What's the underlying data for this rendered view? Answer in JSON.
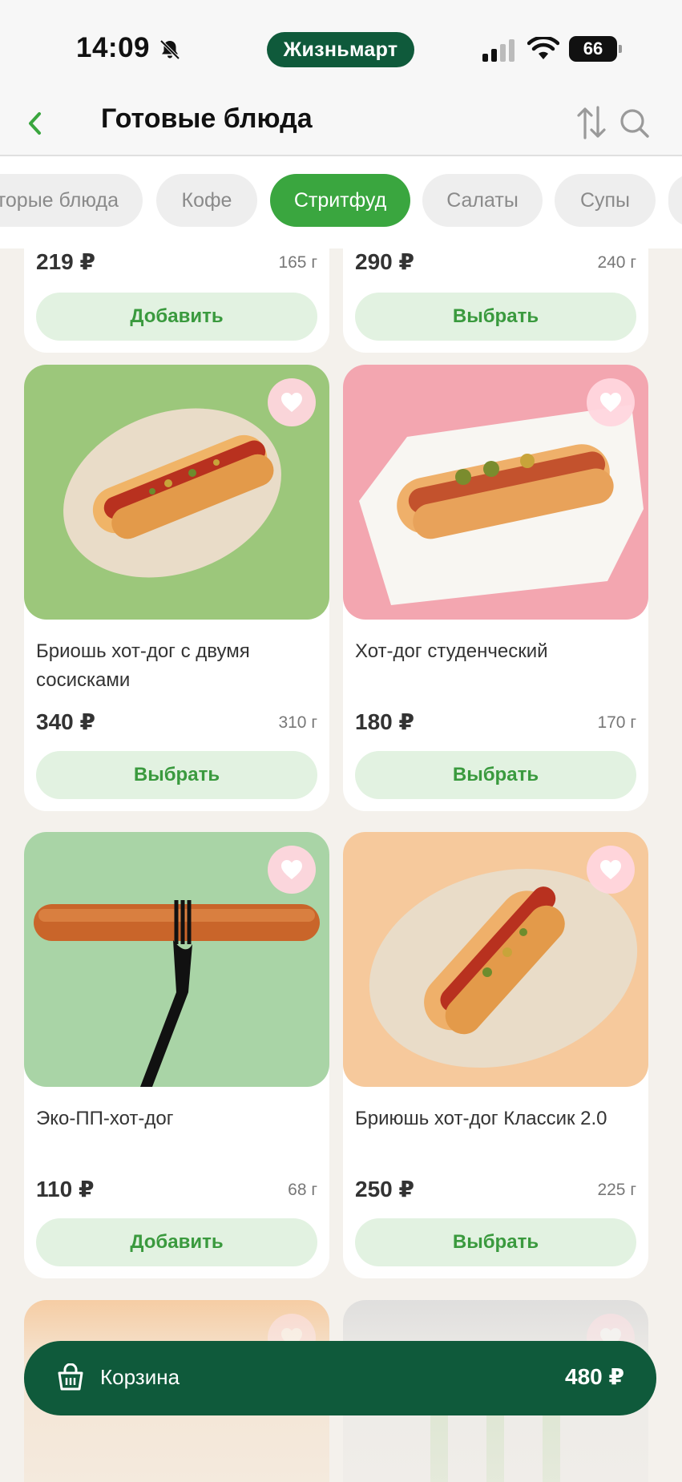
{
  "status_bar": {
    "time": "14:09",
    "brand": "Жизньмарт",
    "battery": "66"
  },
  "header": {
    "title": "Готовые блюда"
  },
  "tabs": [
    {
      "label": "Вторые блюда",
      "active": false
    },
    {
      "label": "Кофе",
      "active": false
    },
    {
      "label": "Стритфуд",
      "active": true
    },
    {
      "label": "Салаты",
      "active": false
    },
    {
      "label": "Супы",
      "active": false
    }
  ],
  "partial_row": [
    {
      "price": "219 ₽",
      "weight": "165 г",
      "button": "Добавить"
    },
    {
      "price": "290 ₽",
      "weight": "240 г",
      "button": "Выбрать"
    }
  ],
  "products": [
    {
      "name": "Бриошь хот-дог с двумя сосисками",
      "price": "340 ₽",
      "weight": "310 г",
      "button": "Выбрать",
      "image": "brioche-hotdog-double-sausage",
      "bg": "#9cc77b"
    },
    {
      "name": "Хот-дог студенческий",
      "price": "180 ₽",
      "weight": "170 г",
      "button": "Выбрать",
      "image": "student-hotdog",
      "bg": "#f3a6b0"
    },
    {
      "name": "Эко-ПП-хот-дог",
      "price": "110 ₽",
      "weight": "68 г",
      "button": "Добавить",
      "image": "eco-pp-hotdog",
      "bg": "#a9d4a6"
    },
    {
      "name": "Бриюшь хот-дог Классик 2.0",
      "price": "250 ₽",
      "weight": "225 г",
      "button": "Выбрать",
      "image": "brioche-hotdog-classic",
      "bg": "#f6c99c"
    }
  ],
  "cart": {
    "label": "Корзина",
    "total": "480 ₽"
  },
  "colors": {
    "brand": "#0f5a3b",
    "accent": "#3aa63f",
    "button_bg": "#e2f2e1",
    "button_text": "#3a9a3e",
    "favorite_bg": "#ffd6de"
  }
}
